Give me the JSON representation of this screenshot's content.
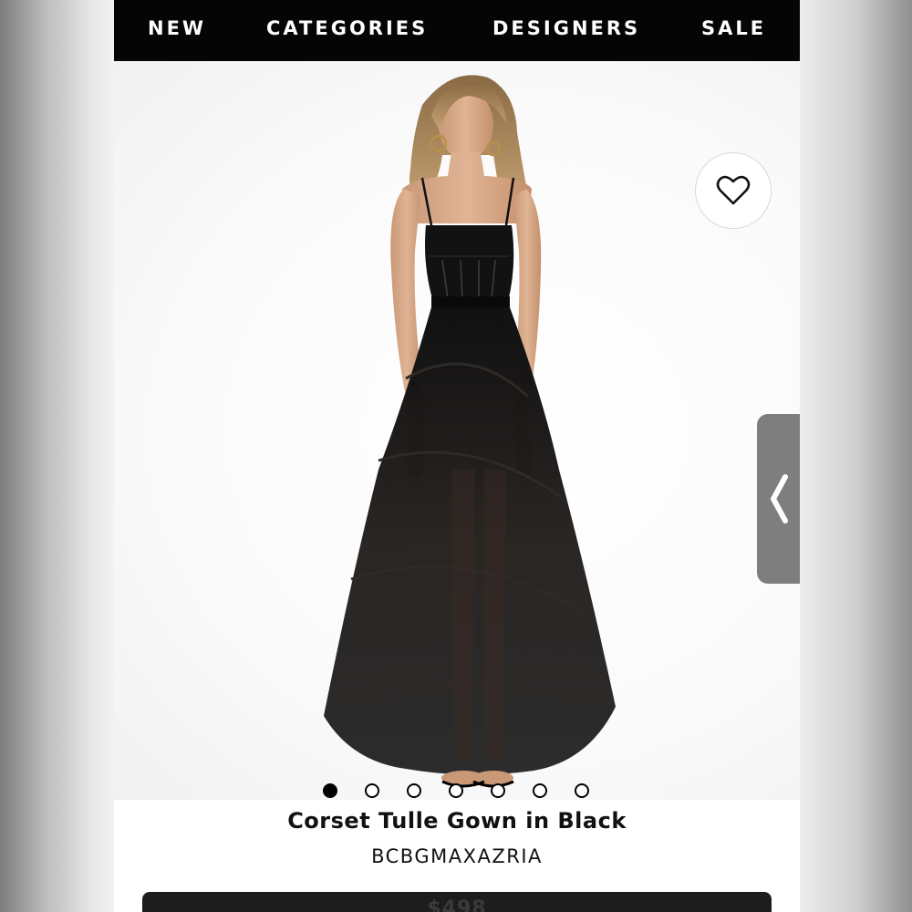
{
  "nav": {
    "items": [
      {
        "label": "NEW"
      },
      {
        "label": "CATEGORIES"
      },
      {
        "label": "DESIGNERS"
      },
      {
        "label": "SALE"
      }
    ]
  },
  "gallery": {
    "favorite_icon": "heart-outline-icon",
    "side_tab_icon": "chevron-left-icon",
    "image_count": 7,
    "active_index": 0
  },
  "product": {
    "title": "Corset Tulle Gown in Black",
    "brand": "BCBGMAXAZRIA",
    "price": "$498"
  },
  "colors": {
    "nav_background": "#050505",
    "side_tab": "#7e7e7e",
    "button_background": "#1d1d1d"
  }
}
